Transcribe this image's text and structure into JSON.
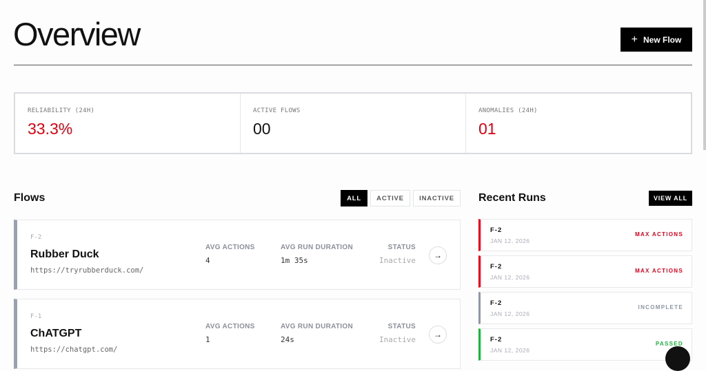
{
  "header": {
    "title": "Overview",
    "new_flow_label": "New Flow",
    "plus": "+"
  },
  "stats": [
    {
      "label": "RELIABILITY (24H)",
      "value": "33.3%"
    },
    {
      "label": "ACTIVE FLOWS",
      "value": "00"
    },
    {
      "label": "ANOMALIES (24H)",
      "value": "01"
    }
  ],
  "flows_section": {
    "title": "Flows",
    "filters": [
      "ALL",
      "ACTIVE",
      "INACTIVE"
    ],
    "selected_filter": "ALL",
    "columns": {
      "avg_actions": "AVG ACTIONS",
      "avg_duration": "AVG RUN DURATION",
      "status": "STATUS"
    },
    "items": [
      {
        "id": "F-2",
        "name": "Rubber Duck",
        "url": "https://tryrubberduck.com/",
        "avg_actions": "4",
        "avg_duration": "1m 35s",
        "status": "Inactive"
      },
      {
        "id": "F-1",
        "name": "ChATGPT",
        "url": "https://chatgpt.com/",
        "avg_actions": "1",
        "avg_duration": "24s",
        "status": "Inactive"
      }
    ],
    "arrow": "→"
  },
  "runs_section": {
    "title": "Recent Runs",
    "view_all_label": "VIEW ALL",
    "items": [
      {
        "id": "F-2",
        "date": "JAN 12, 2026",
        "status": "MAX ACTIONS",
        "color": "#e8001a"
      },
      {
        "id": "F-2",
        "date": "JAN 12, 2026",
        "status": "MAX ACTIONS",
        "color": "#e8001a"
      },
      {
        "id": "F-2",
        "date": "JAN 12, 2026",
        "status": "INCOMPLETE",
        "color": "#8e95a3"
      },
      {
        "id": "F-2",
        "date": "JAN 12, 2026",
        "status": "PASSED",
        "color": "#1fb33e"
      }
    ]
  }
}
